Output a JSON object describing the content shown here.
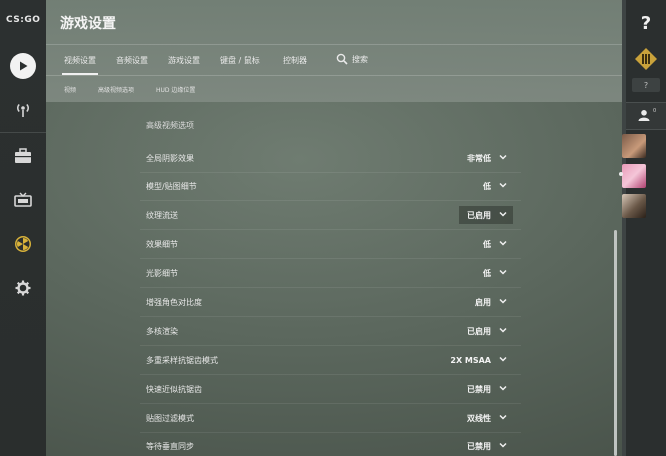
{
  "window": {
    "title": "游戏设置"
  },
  "brand": {
    "logo_text": "CS:GO"
  },
  "nav": {
    "items": [
      {
        "name": "play",
        "icon": "play-icon"
      },
      {
        "name": "broadcast",
        "icon": "broadcast-icon"
      },
      {
        "name": "inventory",
        "icon": "briefcase-icon"
      },
      {
        "name": "watch",
        "icon": "tv-icon"
      },
      {
        "name": "profile",
        "icon": "radiation-icon"
      },
      {
        "name": "settings",
        "icon": "gear-icon"
      }
    ]
  },
  "tabs": [
    {
      "label": "视频设置",
      "active": true
    },
    {
      "label": "音频设置",
      "active": false
    },
    {
      "label": "游戏设置",
      "active": false
    },
    {
      "label": "键盘 / 鼠标",
      "active": false
    },
    {
      "label": "控制器",
      "active": false
    }
  ],
  "search": {
    "label": "搜索",
    "icon": "search-icon"
  },
  "subtabs": [
    {
      "label": "视频"
    },
    {
      "label": "高级视频选项"
    },
    {
      "label": "HUD 边缘位置"
    }
  ],
  "section": {
    "title": "高级视频选项"
  },
  "settings": [
    {
      "label": "全局阴影效果",
      "value": "非常低"
    },
    {
      "label": "模型/贴图细节",
      "value": "低"
    },
    {
      "label": "纹理流送",
      "value": "已启用"
    },
    {
      "label": "效果细节",
      "value": "低"
    },
    {
      "label": "光影细节",
      "value": "低"
    },
    {
      "label": "增强角色对比度",
      "value": "启用"
    },
    {
      "label": "多核渲染",
      "value": "已启用"
    },
    {
      "label": "多重采样抗锯齿模式",
      "value": "2X MSAA"
    },
    {
      "label": "快速近似抗锯齿",
      "value": "已禁用"
    },
    {
      "label": "贴图过滤模式",
      "value": "双线性"
    },
    {
      "label": "等待垂直同步",
      "value": "已禁用"
    }
  ],
  "rightbar": {
    "help": "?",
    "small_help": "?",
    "friends_count": "0"
  },
  "colors": {
    "accent": "#f0f0f0",
    "sidebar": "#2b2f2f",
    "rank_gold": "#c9a23b"
  }
}
